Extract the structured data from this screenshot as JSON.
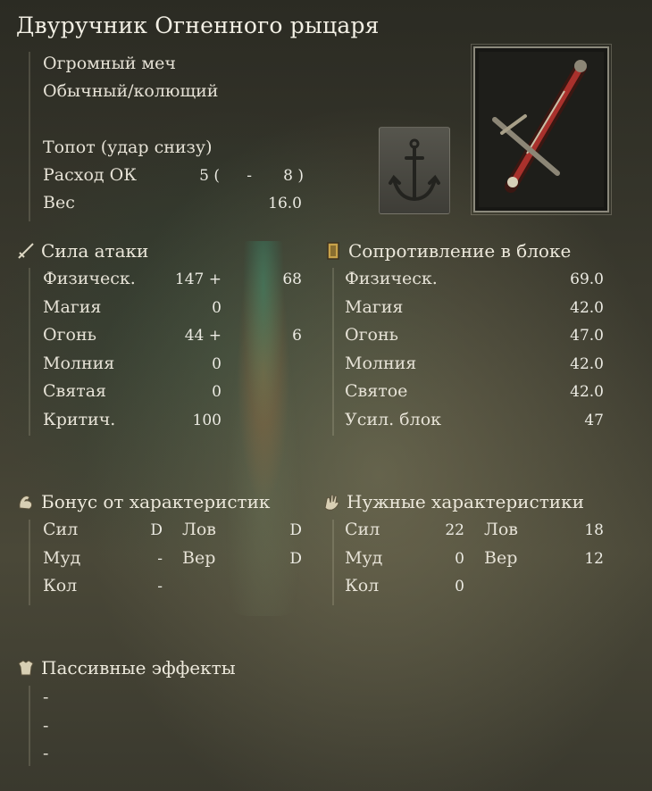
{
  "item": {
    "name": "Двуручник Огненного рыцаря",
    "type": "Огромный меч",
    "damage_type": "Обычный/колющий",
    "skill": "Топот (удар снизу)",
    "fp_label": "Расход ОК",
    "fp_value": "5 (",
    "fp_dash": "-",
    "fp_max": "8 )",
    "weight_label": "Вес",
    "weight_value": "16.0"
  },
  "attack": {
    "title": "Сила атаки",
    "rows": [
      {
        "label": "Физическ.",
        "base": "147 +",
        "bonus": "68"
      },
      {
        "label": "Магия",
        "base": "0",
        "bonus": ""
      },
      {
        "label": "Огонь",
        "base": "44 +",
        "bonus": "6"
      },
      {
        "label": "Молния",
        "base": "0",
        "bonus": ""
      },
      {
        "label": "Святая",
        "base": "0",
        "bonus": ""
      },
      {
        "label": "Критич.",
        "base": "100",
        "bonus": ""
      }
    ]
  },
  "guard": {
    "title": "Сопротивление в блоке",
    "rows": [
      {
        "label": "Физическ.",
        "value": "69.0"
      },
      {
        "label": "Магия",
        "value": "42.0"
      },
      {
        "label": "Огонь",
        "value": "47.0"
      },
      {
        "label": "Молния",
        "value": "42.0"
      },
      {
        "label": "Святое",
        "value": "42.0"
      },
      {
        "label": "Усил. блок",
        "value": "47"
      }
    ]
  },
  "scaling": {
    "title": "Бонус от характеристик",
    "rows": [
      {
        "l1": "Сил",
        "v1": "D",
        "l2": "Лов",
        "v2": "D"
      },
      {
        "l1": "Муд",
        "v1": "-",
        "l2": "Вер",
        "v2": "D"
      },
      {
        "l1": "Кол",
        "v1": "-",
        "l2": "",
        "v2": ""
      }
    ]
  },
  "requirements": {
    "title": "Нужные характеристики",
    "rows": [
      {
        "l1": "Сил",
        "v1": "22",
        "l2": "Лов",
        "v2": "18"
      },
      {
        "l1": "Муд",
        "v1": "0",
        "l2": "Вер",
        "v2": "12"
      },
      {
        "l1": "Кол",
        "v1": "0",
        "l2": "",
        "v2": ""
      }
    ]
  },
  "passive": {
    "title": "Пассивные эффекты",
    "items": [
      "-",
      "-",
      "-"
    ]
  },
  "icons": {
    "attack": "sword-icon",
    "guard": "shield-icon",
    "scaling": "flexed-arm-icon",
    "requirements": "hand-icon",
    "passive": "armor-icon",
    "skill": "anchor-icon",
    "weapon": "greatsword-icon"
  },
  "colors": {
    "text": "#e6e2d6",
    "accent_red": "#a9312c",
    "frame": "#ded9c6"
  }
}
